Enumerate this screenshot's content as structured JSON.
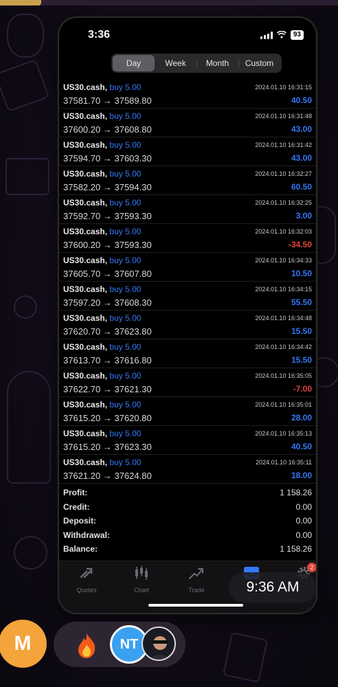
{
  "status_bar": {
    "time": "3:36",
    "battery": "93"
  },
  "period_tabs": [
    {
      "label": "Day",
      "active": true
    },
    {
      "label": "Week",
      "active": false
    },
    {
      "label": "Month",
      "active": false
    },
    {
      "label": "Custom",
      "active": false
    }
  ],
  "deals": [
    {
      "symbol": "US30.cash,",
      "type": "buy 5.00",
      "open": "37581.70",
      "close": "37589.80",
      "time": "2024.01.10 16:31:15",
      "profit": "40.50"
    },
    {
      "symbol": "US30.cash,",
      "type": "buy 5.00",
      "open": "37600.20",
      "close": "37608.80",
      "time": "2024.01.10 16:31:48",
      "profit": "43.00"
    },
    {
      "symbol": "US30.cash,",
      "type": "buy 5.00",
      "open": "37594.70",
      "close": "37603.30",
      "time": "2024.01.10 16:31:42",
      "profit": "43.00"
    },
    {
      "symbol": "US30.cash,",
      "type": "buy 5.00",
      "open": "37582.20",
      "close": "37594.30",
      "time": "2024.01.10 16:32:27",
      "profit": "60.50"
    },
    {
      "symbol": "US30.cash,",
      "type": "buy 5.00",
      "open": "37592.70",
      "close": "37593.30",
      "time": "2024.01.10 16:32:25",
      "profit": "3.00"
    },
    {
      "symbol": "US30.cash,",
      "type": "buy 5.00",
      "open": "37600.20",
      "close": "37593.30",
      "time": "2024.01.10 16:32:03",
      "profit": "-34.50"
    },
    {
      "symbol": "US30.cash,",
      "type": "buy 5.00",
      "open": "37605.70",
      "close": "37607.80",
      "time": "2024.01.10 16:34:33",
      "profit": "10.50"
    },
    {
      "symbol": "US30.cash,",
      "type": "buy 5.00",
      "open": "37597.20",
      "close": "37608.30",
      "time": "2024.01.10 16:34:15",
      "profit": "55.50"
    },
    {
      "symbol": "US30.cash,",
      "type": "buy 5.00",
      "open": "37620.70",
      "close": "37623.80",
      "time": "2024.01.10 16:34:48",
      "profit": "15.50"
    },
    {
      "symbol": "US30.cash,",
      "type": "buy 5.00",
      "open": "37613.70",
      "close": "37616.80",
      "time": "2024.01.10 16:34:42",
      "profit": "15.50"
    },
    {
      "symbol": "US30.cash,",
      "type": "buy 5.00",
      "open": "37622.70",
      "close": "37621.30",
      "time": "2024.01.10 16:35:05",
      "profit": "-7.00"
    },
    {
      "symbol": "US30.cash,",
      "type": "buy 5.00",
      "open": "37615.20",
      "close": "37620.80",
      "time": "2024.01.10 16:35:01",
      "profit": "28.00"
    },
    {
      "symbol": "US30.cash,",
      "type": "buy 5.00",
      "open": "37615.20",
      "close": "37623.30",
      "time": "2024.01.10 16:35:13",
      "profit": "40.50"
    },
    {
      "symbol": "US30.cash,",
      "type": "buy 5.00",
      "open": "37621.20",
      "close": "37624.80",
      "time": "2024.01.10 16:35:11",
      "profit": "18.00"
    }
  ],
  "arrow": "→",
  "summary": [
    {
      "label": "Profit:",
      "value": "1 158.26"
    },
    {
      "label": "Credit:",
      "value": "0.00"
    },
    {
      "label": "Deposit:",
      "value": "0.00"
    },
    {
      "label": "Withdrawal:",
      "value": "0.00"
    },
    {
      "label": "Balance:",
      "value": "1 158.26"
    }
  ],
  "tabbar": {
    "quotes": "Quotes",
    "chart": "Chart",
    "trade": "Trade",
    "settings_badge": "2"
  },
  "pip_clock": "9:36 AM",
  "bottom_avatars": {
    "m": "M",
    "nt": "NT"
  },
  "colors": {
    "buy": "#3478f6",
    "loss": "#e0433b",
    "background": "#000000"
  }
}
